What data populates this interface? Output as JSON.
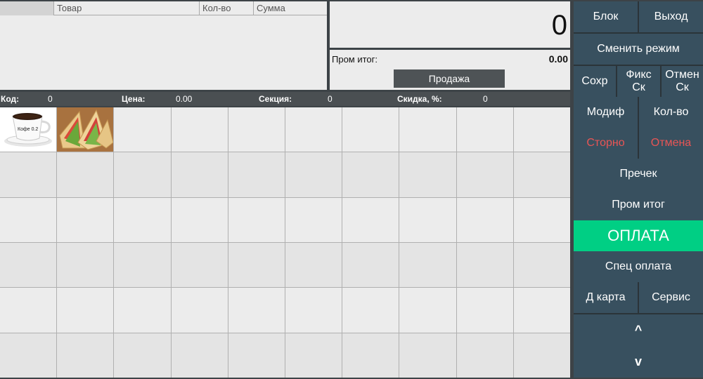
{
  "receipt": {
    "columns": [
      "Товар",
      "Кол-во",
      "Сумма"
    ]
  },
  "display": {
    "value": "0",
    "subtotal_label": "Пром итог:",
    "subtotal_value": "0.00",
    "sale_button": "Продажа"
  },
  "info": {
    "code_label": "Код:",
    "code_value": "0",
    "price_label": "Цена:",
    "price_value": "0.00",
    "section_label": "Секция:",
    "section_value": "0",
    "discount_label": "Скидка, %:",
    "discount_value": "0"
  },
  "products": [
    {
      "icon": "coffee-cup-icon",
      "caption": "Кофе 0.2"
    },
    {
      "icon": "sandwich-icon",
      "caption": ""
    }
  ],
  "side": {
    "block": "Блок",
    "exit": "Выход",
    "change_mode": "Сменить режим",
    "save": "Сохр",
    "fix_disc": "Фикс Ск",
    "cancel_disc": "Отмен Ск",
    "modif": "Модиф",
    "qty": "Кол-во",
    "storno": "Сторно",
    "cancel": "Отмена",
    "precheck": "Пречек",
    "subtotal": "Пром итог",
    "payment": "ОПЛАТА",
    "special_payment": "Спец оплата",
    "card": "Д карта",
    "service": "Сервис",
    "up": "^",
    "down": "v"
  },
  "colors": {
    "accent_pay": "#00cf84",
    "button": "#38505f",
    "danger_text": "#e85555"
  }
}
